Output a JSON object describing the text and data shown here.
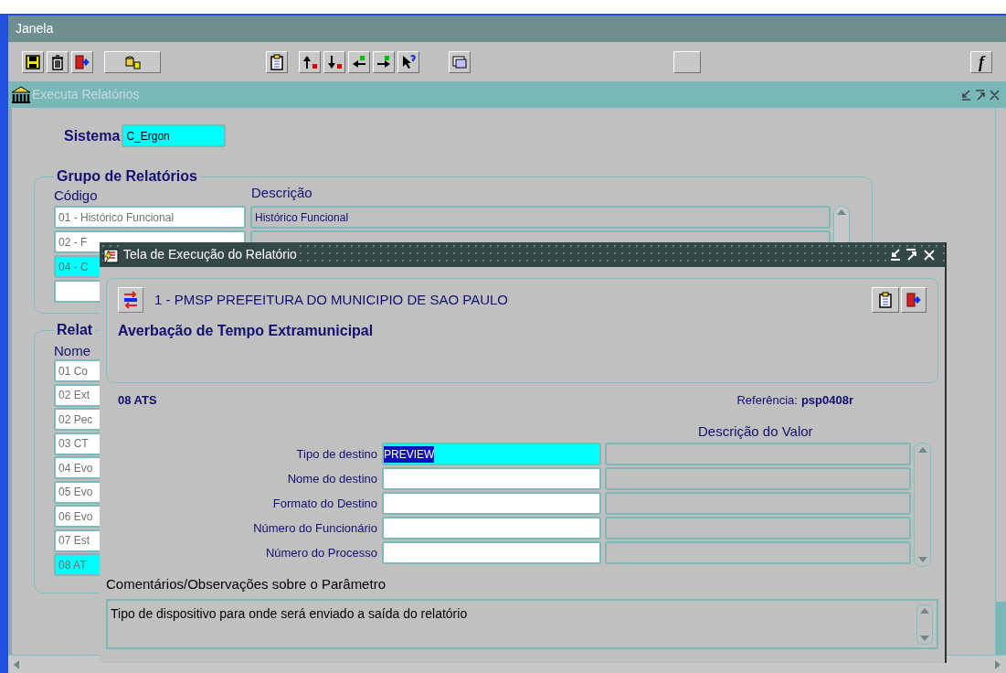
{
  "window": {
    "title": "Janela"
  },
  "toolbar": {
    "function_label": "f"
  },
  "form": {
    "title": "Executa Relatórios",
    "system": {
      "label": "Sistema",
      "value": "C_Ergon"
    },
    "group": {
      "title": "Grupo de Relatórios",
      "columns": [
        "Código",
        "Descrição"
      ],
      "rows": [
        {
          "code": "01 - Histórico Funcional",
          "description": "Histórico Funcional",
          "selected": false
        },
        {
          "code": "02 - F",
          "selected": false
        },
        {
          "code": "04 - C",
          "selected": true
        },
        {
          "selected": false
        }
      ]
    },
    "reports": {
      "title": "Relat",
      "column": "Nome",
      "rows": [
        {
          "name": "01 Co",
          "selected": false
        },
        {
          "name": "02 Ext",
          "selected": false
        },
        {
          "name": "02 Pec",
          "selected": false
        },
        {
          "name": "03 CT",
          "selected": false
        },
        {
          "name": "04 Evo",
          "selected": false
        },
        {
          "name": "05 Evo",
          "selected": false
        },
        {
          "name": "06 Evo",
          "selected": false
        },
        {
          "name": "07 Est",
          "selected": false
        },
        {
          "name": "08 AT",
          "selected": true
        }
      ]
    }
  },
  "dialog": {
    "title": "Tela de Execução do Relatório",
    "organization": "1 - PMSP PREFEITURA DO MUNICIPIO DE SAO PAULO",
    "report_title": "Averbação de Tempo Extramunicipal",
    "report_code": "08 ATS",
    "reference_label": "Referência:",
    "reference_value": "psp0408r",
    "value_column": "Descrição do Valor",
    "parameters": [
      {
        "label": "Tipo de destino",
        "value": "PREVIEW",
        "selected": true
      },
      {
        "label": "Nome do destino",
        "selected": false
      },
      {
        "label": "Formato do Destino",
        "selected": false
      },
      {
        "label": "Número do Funcionário",
        "selected": false
      },
      {
        "label": "Número do Processo",
        "selected": false
      }
    ],
    "comments_label": "Comentários/Observações sobre o Parâmetro",
    "comment": "Tipo de dispositivo para onde será enviado a saída do relatório"
  }
}
